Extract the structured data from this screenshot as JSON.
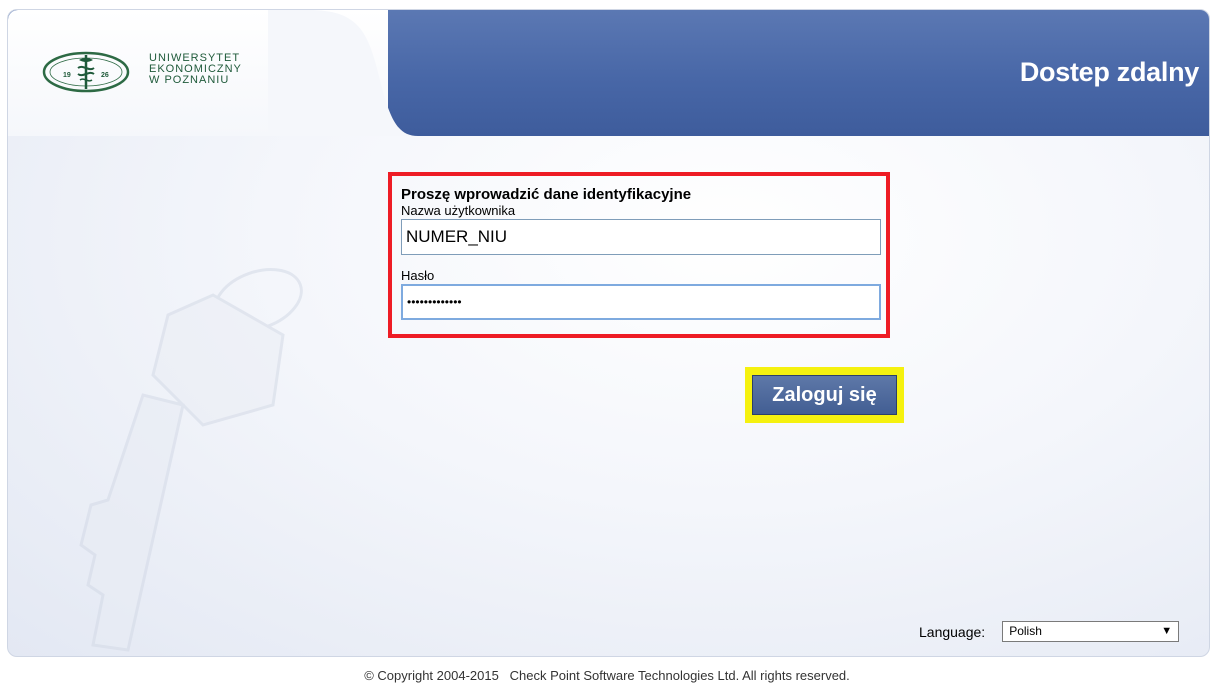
{
  "header": {
    "title": "Dostep zdalny",
    "logo": {
      "line1": "UNIWERSYTET",
      "line2": "EKONOMICZNY",
      "line3": "W POZNANIU",
      "emblem_left": "19",
      "emblem_right": "26"
    }
  },
  "login_form": {
    "heading": "Proszę wprowadzić dane identyfikacyjne",
    "username_label": "Nazwa użytkownika",
    "username_value": "NUMER_NIU",
    "password_label": "Hasło",
    "password_masked": "•••••••••••••",
    "submit_label": "Zaloguj się"
  },
  "language": {
    "label": "Language:",
    "selected": "Polish",
    "arrow": "▼"
  },
  "footer": {
    "copyright": "© Copyright 2004-2015   Check Point Software Technologies Ltd. All rights reserved."
  },
  "colors": {
    "header_blue": "#4867a7",
    "highlight_red": "#ee1c25",
    "highlight_yellow": "#f5f10f",
    "logo_green": "#1f5a3a"
  },
  "icons": {
    "emblem": "university-emblem-icon",
    "watermark": "key-watermark-icon",
    "dropdown": "chevron-down-icon"
  }
}
